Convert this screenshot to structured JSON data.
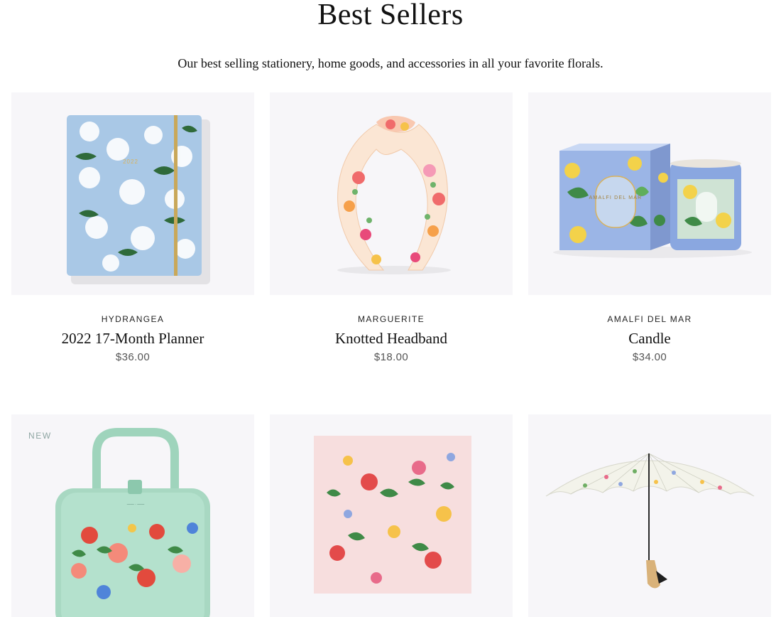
{
  "page": {
    "title": "Best Sellers",
    "subtitle": "Our best selling stationery, home goods, and accessories in all your favorite florals."
  },
  "products": [
    {
      "collection": "HYDRANGEA",
      "name": "2022 17-Month Planner",
      "price": "$36.00",
      "cover_year": "2022"
    },
    {
      "collection": "MARGUERITE",
      "name": "Knotted Headband",
      "price": "$18.00"
    },
    {
      "collection": "AMALFI DEL MAR",
      "name": "Candle",
      "price": "$34.00",
      "box_label": "AMALFI DEL MAR"
    },
    {
      "badge": "NEW"
    },
    {},
    {}
  ],
  "colors": {
    "tile_background": "#f7f6f9",
    "planner_blue": "#a9c8e6",
    "candle_blue": "#8aa7e0",
    "bag_mint": "#a8d8c2",
    "scarf_pink": "#f7dede",
    "badge_text": "#8fa6a3"
  }
}
